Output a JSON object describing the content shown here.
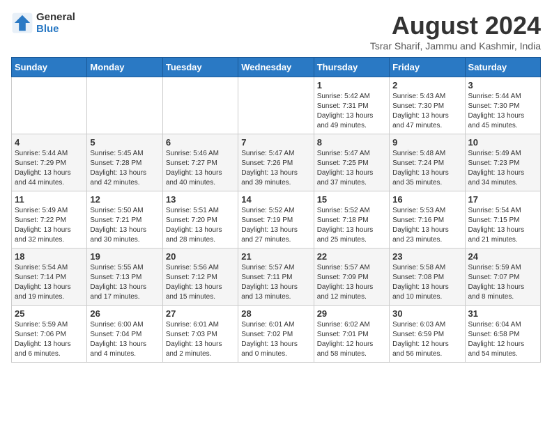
{
  "logo": {
    "general": "General",
    "blue": "Blue"
  },
  "header": {
    "month_year": "August 2024",
    "location": "Tsrar Sharif, Jammu and Kashmir, India"
  },
  "weekdays": [
    "Sunday",
    "Monday",
    "Tuesday",
    "Wednesday",
    "Thursday",
    "Friday",
    "Saturday"
  ],
  "weeks": [
    [
      {
        "day": "",
        "info": ""
      },
      {
        "day": "",
        "info": ""
      },
      {
        "day": "",
        "info": ""
      },
      {
        "day": "",
        "info": ""
      },
      {
        "day": "1",
        "info": "Sunrise: 5:42 AM\nSunset: 7:31 PM\nDaylight: 13 hours\nand 49 minutes."
      },
      {
        "day": "2",
        "info": "Sunrise: 5:43 AM\nSunset: 7:30 PM\nDaylight: 13 hours\nand 47 minutes."
      },
      {
        "day": "3",
        "info": "Sunrise: 5:44 AM\nSunset: 7:30 PM\nDaylight: 13 hours\nand 45 minutes."
      }
    ],
    [
      {
        "day": "4",
        "info": "Sunrise: 5:44 AM\nSunset: 7:29 PM\nDaylight: 13 hours\nand 44 minutes."
      },
      {
        "day": "5",
        "info": "Sunrise: 5:45 AM\nSunset: 7:28 PM\nDaylight: 13 hours\nand 42 minutes."
      },
      {
        "day": "6",
        "info": "Sunrise: 5:46 AM\nSunset: 7:27 PM\nDaylight: 13 hours\nand 40 minutes."
      },
      {
        "day": "7",
        "info": "Sunrise: 5:47 AM\nSunset: 7:26 PM\nDaylight: 13 hours\nand 39 minutes."
      },
      {
        "day": "8",
        "info": "Sunrise: 5:47 AM\nSunset: 7:25 PM\nDaylight: 13 hours\nand 37 minutes."
      },
      {
        "day": "9",
        "info": "Sunrise: 5:48 AM\nSunset: 7:24 PM\nDaylight: 13 hours\nand 35 minutes."
      },
      {
        "day": "10",
        "info": "Sunrise: 5:49 AM\nSunset: 7:23 PM\nDaylight: 13 hours\nand 34 minutes."
      }
    ],
    [
      {
        "day": "11",
        "info": "Sunrise: 5:49 AM\nSunset: 7:22 PM\nDaylight: 13 hours\nand 32 minutes."
      },
      {
        "day": "12",
        "info": "Sunrise: 5:50 AM\nSunset: 7:21 PM\nDaylight: 13 hours\nand 30 minutes."
      },
      {
        "day": "13",
        "info": "Sunrise: 5:51 AM\nSunset: 7:20 PM\nDaylight: 13 hours\nand 28 minutes."
      },
      {
        "day": "14",
        "info": "Sunrise: 5:52 AM\nSunset: 7:19 PM\nDaylight: 13 hours\nand 27 minutes."
      },
      {
        "day": "15",
        "info": "Sunrise: 5:52 AM\nSunset: 7:18 PM\nDaylight: 13 hours\nand 25 minutes."
      },
      {
        "day": "16",
        "info": "Sunrise: 5:53 AM\nSunset: 7:16 PM\nDaylight: 13 hours\nand 23 minutes."
      },
      {
        "day": "17",
        "info": "Sunrise: 5:54 AM\nSunset: 7:15 PM\nDaylight: 13 hours\nand 21 minutes."
      }
    ],
    [
      {
        "day": "18",
        "info": "Sunrise: 5:54 AM\nSunset: 7:14 PM\nDaylight: 13 hours\nand 19 minutes."
      },
      {
        "day": "19",
        "info": "Sunrise: 5:55 AM\nSunset: 7:13 PM\nDaylight: 13 hours\nand 17 minutes."
      },
      {
        "day": "20",
        "info": "Sunrise: 5:56 AM\nSunset: 7:12 PM\nDaylight: 13 hours\nand 15 minutes."
      },
      {
        "day": "21",
        "info": "Sunrise: 5:57 AM\nSunset: 7:11 PM\nDaylight: 13 hours\nand 13 minutes."
      },
      {
        "day": "22",
        "info": "Sunrise: 5:57 AM\nSunset: 7:09 PM\nDaylight: 13 hours\nand 12 minutes."
      },
      {
        "day": "23",
        "info": "Sunrise: 5:58 AM\nSunset: 7:08 PM\nDaylight: 13 hours\nand 10 minutes."
      },
      {
        "day": "24",
        "info": "Sunrise: 5:59 AM\nSunset: 7:07 PM\nDaylight: 13 hours\nand 8 minutes."
      }
    ],
    [
      {
        "day": "25",
        "info": "Sunrise: 5:59 AM\nSunset: 7:06 PM\nDaylight: 13 hours\nand 6 minutes."
      },
      {
        "day": "26",
        "info": "Sunrise: 6:00 AM\nSunset: 7:04 PM\nDaylight: 13 hours\nand 4 minutes."
      },
      {
        "day": "27",
        "info": "Sunrise: 6:01 AM\nSunset: 7:03 PM\nDaylight: 13 hours\nand 2 minutes."
      },
      {
        "day": "28",
        "info": "Sunrise: 6:01 AM\nSunset: 7:02 PM\nDaylight: 13 hours\nand 0 minutes."
      },
      {
        "day": "29",
        "info": "Sunrise: 6:02 AM\nSunset: 7:01 PM\nDaylight: 12 hours\nand 58 minutes."
      },
      {
        "day": "30",
        "info": "Sunrise: 6:03 AM\nSunset: 6:59 PM\nDaylight: 12 hours\nand 56 minutes."
      },
      {
        "day": "31",
        "info": "Sunrise: 6:04 AM\nSunset: 6:58 PM\nDaylight: 12 hours\nand 54 minutes."
      }
    ]
  ]
}
